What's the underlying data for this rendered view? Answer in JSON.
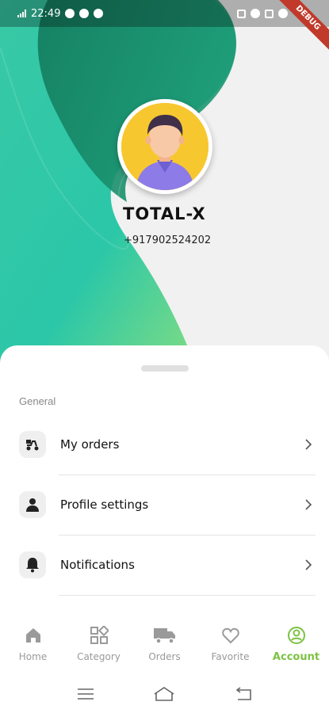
{
  "status_bar": {
    "time": "22:49",
    "debug_banner": "DEBUG"
  },
  "profile": {
    "name": "TOTAL-X",
    "phone": "+917902524202"
  },
  "sheet": {
    "section_label": "General",
    "items": [
      {
        "label": "My orders",
        "icon": "delivery-scooter-icon"
      },
      {
        "label": "Profile settings",
        "icon": "person-icon"
      },
      {
        "label": "Notifications",
        "icon": "bell-icon"
      }
    ]
  },
  "bottom_nav": {
    "items": [
      {
        "label": "Home",
        "icon": "home-icon"
      },
      {
        "label": "Category",
        "icon": "grid-icon"
      },
      {
        "label": "Orders",
        "icon": "truck-icon"
      },
      {
        "label": "Favorite",
        "icon": "heart-icon"
      },
      {
        "label": "Account",
        "icon": "account-icon",
        "active": true
      }
    ]
  },
  "colors": {
    "accent": "#7cc242",
    "teal_dark": "#1a8a6c",
    "teal_light": "#2fd0b0",
    "green_light": "#a3e06a"
  }
}
